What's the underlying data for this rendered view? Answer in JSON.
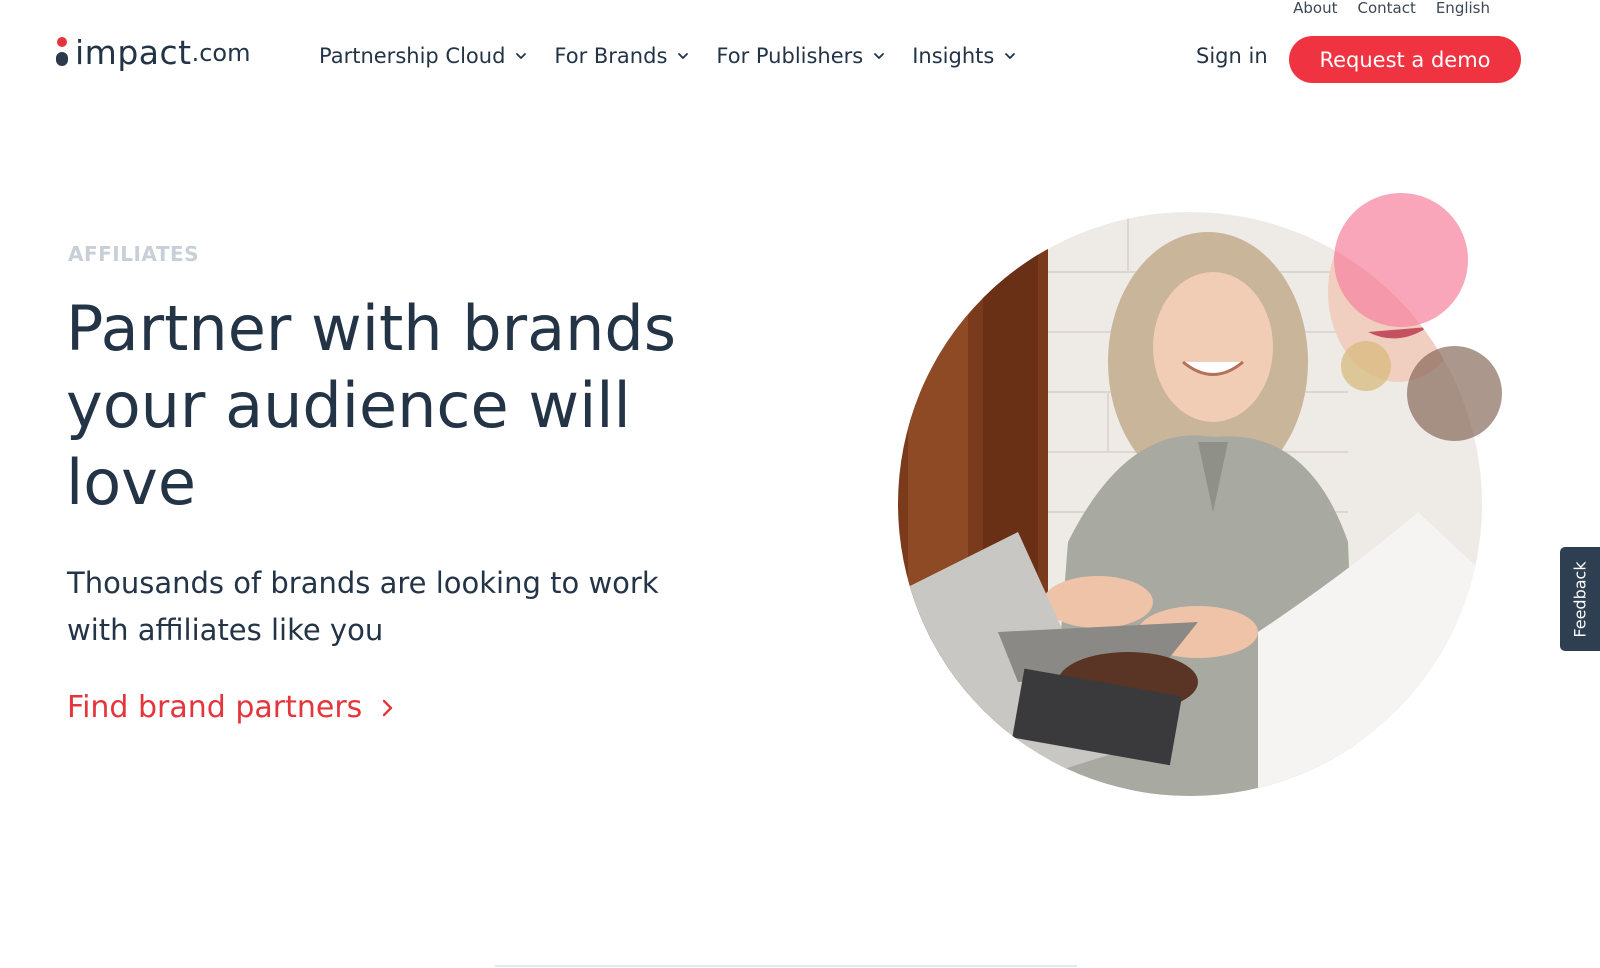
{
  "utility_nav": {
    "about": "About",
    "contact": "Contact",
    "language": "English"
  },
  "logo": {
    "main": "impact",
    "tld": ".com"
  },
  "main_nav": [
    {
      "label": "Partnership Cloud",
      "icon": "chevron-down-icon"
    },
    {
      "label": "For Brands",
      "icon": "chevron-down-icon"
    },
    {
      "label": "For Publishers",
      "icon": "chevron-down-icon"
    },
    {
      "label": "Insights",
      "icon": "chevron-down-icon"
    }
  ],
  "header_actions": {
    "sign_in": "Sign in",
    "demo": "Request a demo"
  },
  "hero": {
    "eyebrow": "AFFILIATES",
    "headline_lines": [
      "Partner with brands",
      "your audience will",
      "love"
    ],
    "subhead_lines": [
      "Thousands of brands are looking to work",
      "with affiliates like you"
    ],
    "cta": "Find brand partners",
    "cta_icon": "chevron-right-icon"
  },
  "feedback": {
    "label": "Feedback"
  },
  "colors": {
    "brand_red": "#ef3340",
    "text_dark": "#243447",
    "eyebrow_gray": "#c9cfd6",
    "feedback_bg": "#2e3f52"
  }
}
